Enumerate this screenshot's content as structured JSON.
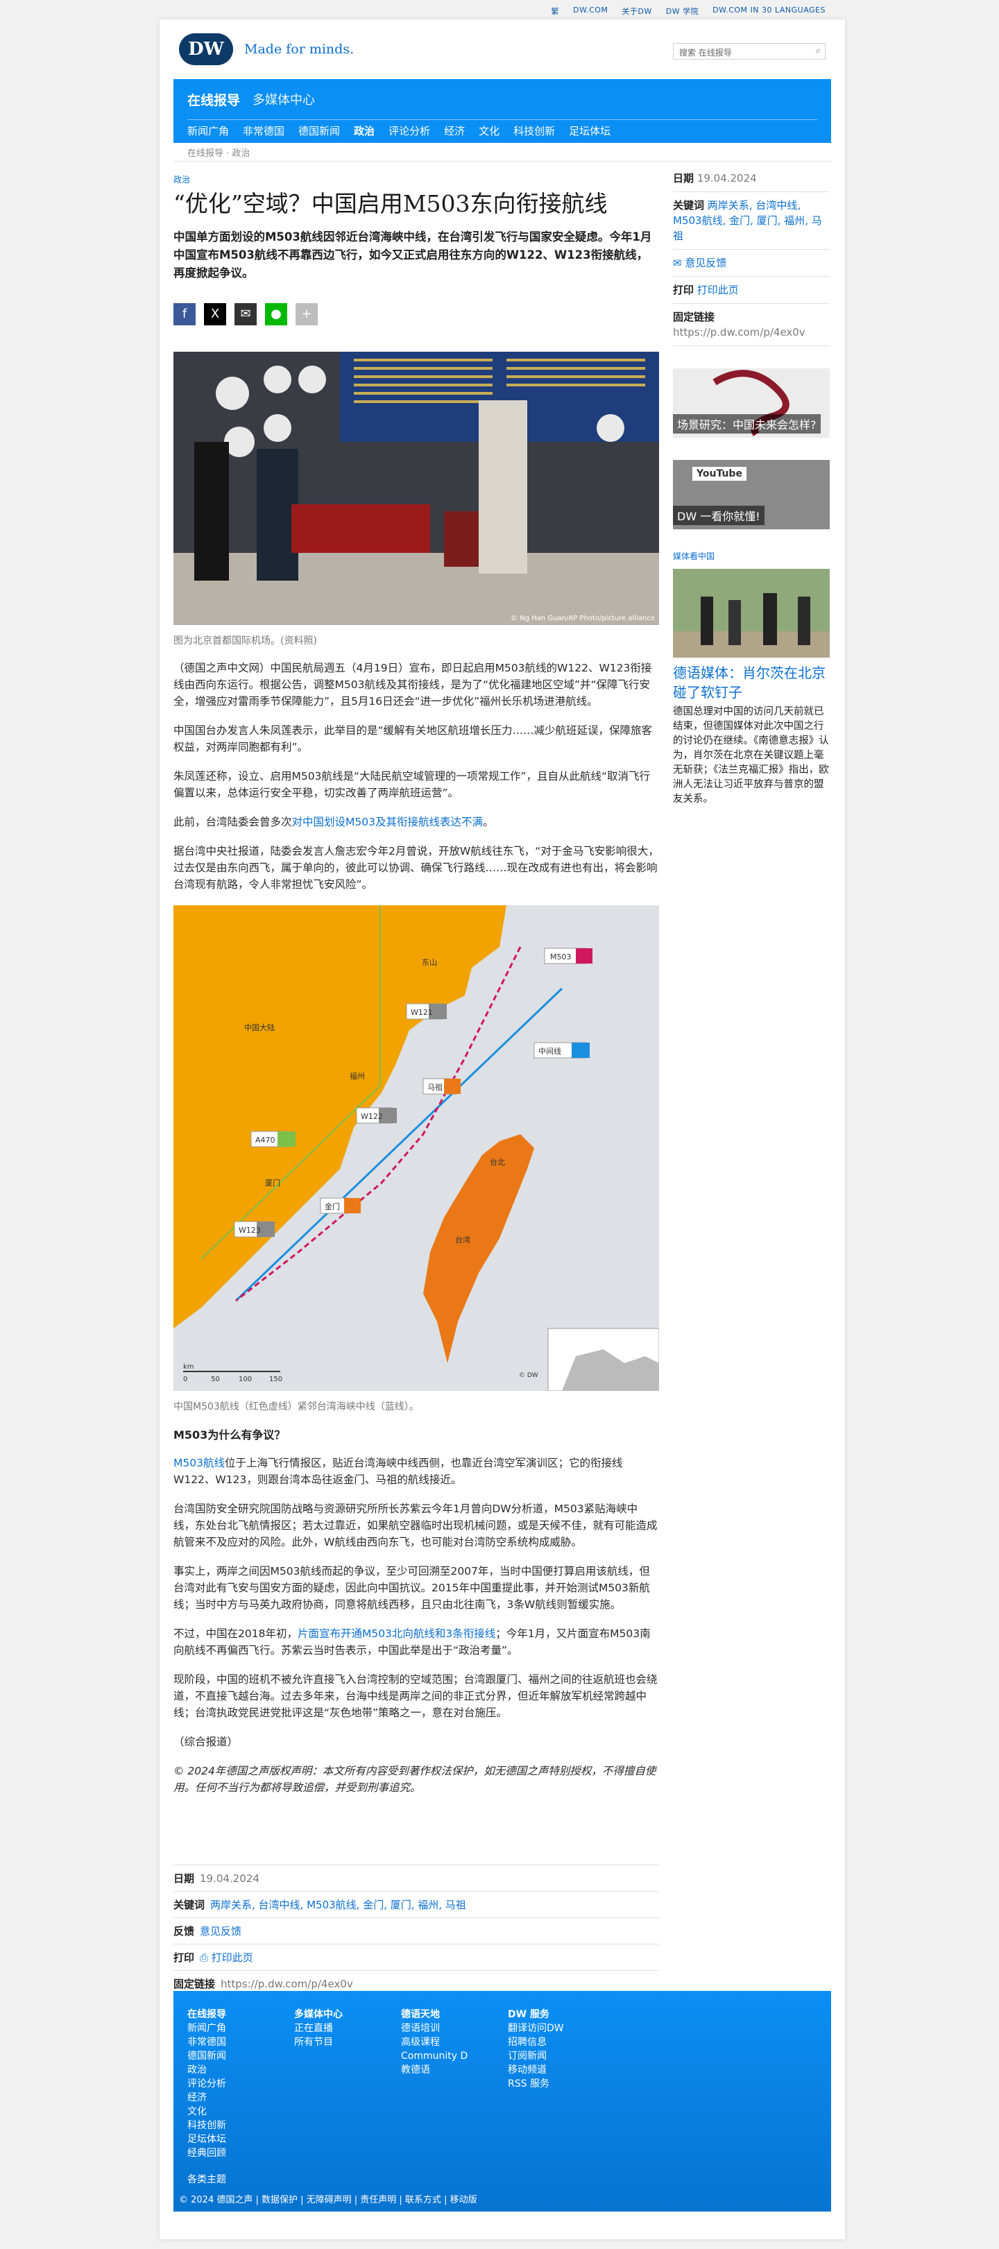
{
  "topbar": [
    "繁",
    "DW.COM",
    "关于DW",
    "DW 学院",
    "DW.COM IN 30 LANGUAGES"
  ],
  "brand": {
    "logo": "DW",
    "slogan": "Made for minds."
  },
  "search": {
    "placeholder": "搜索 在线报导"
  },
  "nav": {
    "title": "在线报导",
    "media": "多媒体中心",
    "sub": [
      "新闻广角",
      "非常德国",
      "德国新闻",
      "政治",
      "评论分析",
      "经济",
      "文化",
      "科技创新",
      "足坛体坛"
    ]
  },
  "breadcrumb": "在线报导 · 政治",
  "article": {
    "kicker": "政治",
    "title": "“优化”空域？中国启用M503东向衔接航线",
    "teaser": "中国单方面划设的M503航线因邻近台湾海峡中线，在台湾引发飞行与国家安全疑虑。今年1月中国宣布M503航线不再靠西边飞行，如今又正式启用往东方向的W122、W123衔接航线，再度掀起争议。",
    "share": [
      "f",
      "X",
      "✉",
      "●",
      "+"
    ],
    "photo_credit": "© Ng Han Guan/AP Photo/picture alliance",
    "caption": "图为北京首都国际机场。(资料照)",
    "p1": "（德国之声中文网）中国民航局週五（4月19日）宣布，即日起启用M503航线的W122、W123衔接线由西向东运行。根据公告，调整M503航线及其衔接线，是为了“优化福建地区空域”并“保障飞行安全，增强应对雷雨季节保障能力”，且5月16日还会“进一步优化”福州长乐机场进港航线。",
    "p2": "中国国台办发言人朱凤莲表示，此举目的是“缓解有关地区航班增长压力……减少航班延误，保障旅客权益，对两岸同胞都有利”。",
    "p3": "朱凤莲还称，设立、启用M503航线是“大陆民航空域管理的一项常规工作”，且自从此航线“取消飞行偏置以来，总体运行安全平稳，切实改善了两岸航班运营”。",
    "p4_pre": "此前，台湾陆委会曾多次",
    "p4_link": "对中国划设M503及其衔接航线表达不满",
    "p4_post": "。",
    "p5": "据台湾中央社报道，陆委会发言人詹志宏今年2月曾说，开放W航线往东飞，“对于金马飞安影响很大，过去仅是由东向西飞，属于单向的，彼此可以协调、确保飞行路线……现在改成有进也有出，将会影响台湾现有航路，令人非常担忧飞安风险”。",
    "map": {
      "labels": [
        "M503",
        "中间线",
        "东山",
        "中国大陆",
        "W121",
        "福州",
        "马祖",
        "W122",
        "A470",
        "厦门",
        "金门",
        "台北",
        "W123",
        "台湾",
        "© DW"
      ],
      "scale": [
        "km",
        "0",
        "50",
        "100",
        "150"
      ]
    },
    "map_caption": "中国M503航线（红色虚线）紧邻台湾海峡中线（蓝线）。",
    "h_why": "M503为什么有争议？",
    "p6_link": "M503航线",
    "p6": "位于上海飞行情报区，贴近台湾海峡中线西侧，也靠近台湾空军演训区；它的衔接线W122、W123，则跟台湾本岛往返金门、马祖的航线接近。",
    "p7": "台湾国防安全研究院国防战略与资源研究所所长苏紫云今年1月曾向DW分析道，M503紧贴海峡中线，东处台北飞航情报区；若太过靠近，如果航空器临时出现机械问题，或是天候不佳，就有可能造成航管来不及应对的风险。此外，W航线由西向东飞，也可能对台湾防空系统构成威胁。",
    "p8": "事实上，两岸之间因M503航线而起的争议，至少可回溯至2007年，当时中国便打算启用该航线，但台湾对此有飞安与国安方面的疑虑，因此向中国抗议。2015年中国重提此事，并开始测试M503新航线；当时中方与马英九政府协商，同意将航线西移，且只由北往南飞，3条W航线则暂缓实施。",
    "p9_pre": "不过，中国在2018年初，",
    "p9_link": "片面宣布开通M503北向航线和3条衔接线",
    "p9_post": "；今年1月，又片面宣布M503南向航线不再偏西飞行。苏紫云当时告表示，中国此举是出于“政治考量”。",
    "p10": "现阶段，中国的班机不被允许直接飞入台湾控制的空域范围；台湾跟厦门、福州之间的往返航班也会绕道，不直接飞越台海。过去多年来，台海中线是两岸之间的非正式分界，但近年解放军机经常跨越中线；台湾执政党民进党批评这是“灰色地带”策略之一，意在对台施压。",
    "p11": "（综合报道）",
    "copyright": "© 2024年德国之声版权声明：本文所有内容受到著作权法保护，如无德国之声特别授权，不得擅自使用。任何不当行为都将导致追偿，并受到刑事追究。"
  },
  "info": {
    "date_label": "日期",
    "date": "19.04.2024",
    "keywords_label": "关键词",
    "keywords": "两岸关系, 台湾中线, M503航线, 金门, 厦门, 福州, 马祖",
    "feedback_label": "反馈",
    "feedback": "意见反馈",
    "print_label": "打印",
    "print": "打印此页",
    "link_label": "固定链接",
    "link": "https://p.dw.com/p/4ex0v"
  },
  "sidebar": {
    "date_label": "日期",
    "date": "19.04.2024",
    "keywords_label": "关键词",
    "keywords": "两岸关系, 台湾中线, M503航线, 金门, 厦门, 福州, 马祖",
    "feedback": "意见反馈",
    "print_label": "打印",
    "print": "打印此页",
    "link_label": "固定链接",
    "link": "https://p.dw.com/p/4ex0v",
    "promo1": "场景研究：中国未来会怎样?",
    "promo2": "DW 一看你就懂!",
    "youtube": "YouTube",
    "section": "媒体看中国",
    "story_title": "德语媒体：肖尔茨在北京碰了软钉子",
    "story_text": "德国总理对中国的访问几天前就已结束，但德国媒体对此次中国之行的讨论仍在继续。《南德意志报》认为，肖尔茨在北京在关键议题上毫无斩获；《法兰克福汇报》指出，欧洲人无法让习近平放弃与普京的盟友关系。"
  },
  "footer": {
    "col1_title": "在线报导",
    "col1": [
      "新闻广角",
      "非常德国",
      "德国新闻",
      "政治",
      "评论分析",
      "经济",
      "文化",
      "科技创新",
      "足坛体坛",
      "经典回顾"
    ],
    "col1_extra": "各类主题",
    "col2_title": "多媒体中心",
    "col2": [
      "正在直播",
      "所有节目"
    ],
    "col3_title": "德语天地",
    "col3": [
      "德语培训",
      "高级课程",
      "Community D",
      "教德语"
    ],
    "col4_title": "DW 服务",
    "col4": [
      "翻译访问DW",
      "招聘信息",
      "订阅新闻",
      "移动频道",
      "RSS 服务"
    ],
    "bottom": "© 2024 德国之声 | 数据保护 | 无障碍声明 | 责任声明 | 联系方式 | 移动版"
  },
  "colors": {
    "dw_blue": "#0a8ff5",
    "link": "#0b6fd1",
    "route_red": "#d0185e",
    "median_blue": "#1a8fe0",
    "land": "#eb7817",
    "mainland": "#f2a300"
  }
}
